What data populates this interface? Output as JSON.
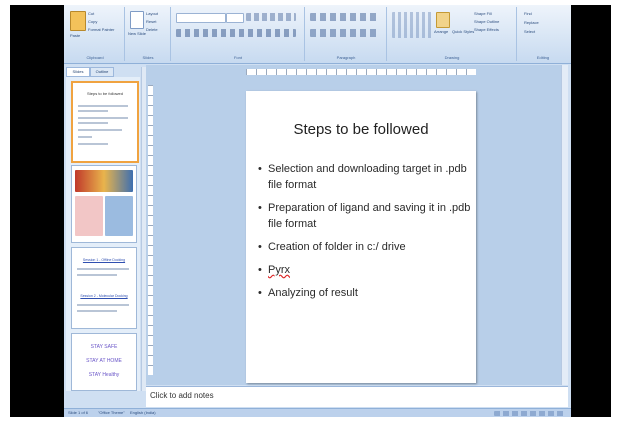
{
  "ribbon": {
    "groups": [
      "Clipboard",
      "Slides",
      "Font",
      "Paragraph",
      "Drawing",
      "Editing"
    ],
    "paste": "Paste",
    "cut": "Cut",
    "copy": "Copy",
    "format_painter": "Format Painter",
    "new_slide": "New Slide",
    "layout": "Layout",
    "reset": "Reset",
    "delete": "Delete",
    "arrange": "Arrange",
    "quick_styles": "Quick Styles",
    "shape_fill": "Shape Fill",
    "shape_outline": "Shape Outline",
    "shape_effects": "Shape Effects",
    "find": "Find",
    "replace": "Replace",
    "select": "Select"
  },
  "tabs": [
    "Slides",
    "Outline"
  ],
  "thumbnails": {
    "t1_title": "Steps to be followed",
    "t3_link1": "Session 1 - Offline Docking",
    "t3_link2": "Session 2 - Molecular Docking",
    "t4_lines": [
      "STAY SAFE",
      "STAY AT HOME",
      "STAY Healthy"
    ]
  },
  "slide": {
    "title": "Steps to be followed",
    "bullets": [
      "Selection and downloading target in .pdb file format",
      "Preparation of ligand and saving it in .pdb file format",
      "Creation of folder in c:/ drive",
      "Pyrx",
      "Analyzing of result"
    ]
  },
  "notes_placeholder": "Click to add notes",
  "status": {
    "slide_count": "Slide 1 of 6",
    "theme": "\"Office Theme\"",
    "language": "English (India)"
  }
}
